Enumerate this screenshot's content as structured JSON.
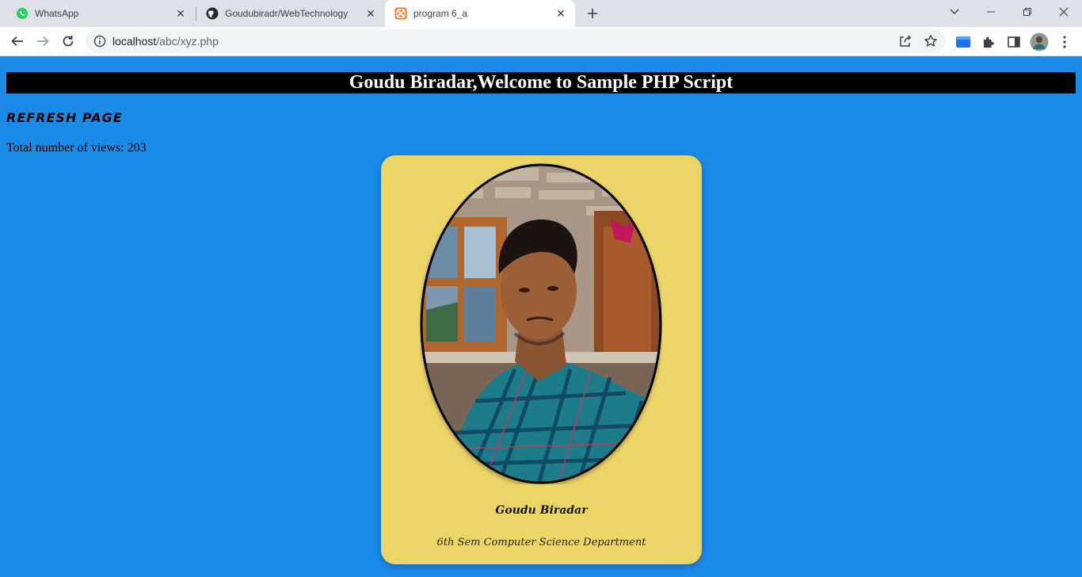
{
  "browser": {
    "tabs": [
      {
        "title": "WhatsApp",
        "icon": "whatsapp-icon"
      },
      {
        "title": "Goudubiradr/WebTechnology",
        "icon": "github-icon"
      },
      {
        "title": "program 6_a",
        "icon": "xampp-icon",
        "active": true
      }
    ],
    "address": {
      "host": "localhost",
      "path": "/abc/xyz.php"
    }
  },
  "page": {
    "heading": "Goudu Biradar,Welcome to Sample PHP Script",
    "refresh_link": "Refresh page",
    "views_text": "Total number of views: 203",
    "card": {
      "name": "Goudu Biradar",
      "department": "6th Sem Computer Science Department"
    }
  },
  "colors": {
    "page_bg": "#1b8be8",
    "card_bg": "#ecd567",
    "banner_bg": "#000000"
  }
}
